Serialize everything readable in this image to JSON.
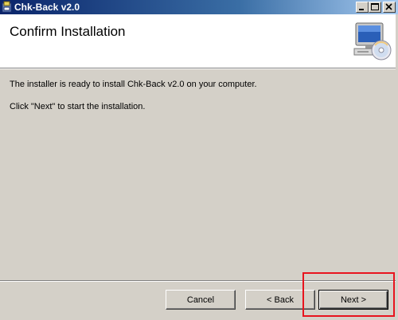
{
  "window": {
    "title": "Chk-Back v2.0",
    "buttons": {
      "minimize_icon": "minimize-icon",
      "maximize_icon": "maximize-icon",
      "close_icon": "close-icon"
    }
  },
  "header": {
    "title": "Confirm Installation",
    "icon": "computer-cd-icon"
  },
  "body": {
    "message_1": "The installer is ready to install Chk-Back v2.0 on your computer.",
    "message_2": "Click \"Next\" to start the installation."
  },
  "footer": {
    "cancel_label": "Cancel",
    "back_label": "< Back",
    "next_label": "Next >"
  },
  "colors": {
    "titlebar_start": "#0a246a",
    "titlebar_end": "#a6caf0",
    "dialog_face": "#d4d0c8",
    "highlight": "#e8141e"
  }
}
